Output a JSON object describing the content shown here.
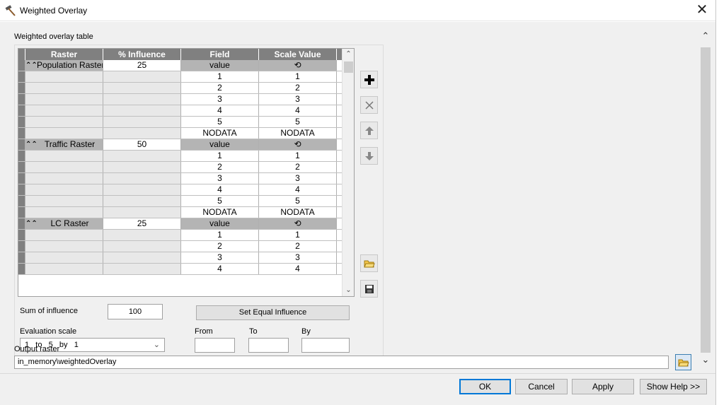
{
  "window": {
    "title": "Weighted Overlay",
    "icon": "hammer-icon",
    "close_glyph": "✕"
  },
  "section_label": "Weighted overlay table",
  "table": {
    "headers": [
      "Raster",
      "% Influence",
      "Field",
      "Scale Value"
    ],
    "scale_header_glyph": "⟲",
    "groups": [
      {
        "raster": "Population Raster",
        "influence": "25",
        "field": "value",
        "rows": [
          [
            "1",
            "1"
          ],
          [
            "2",
            "2"
          ],
          [
            "3",
            "3"
          ],
          [
            "4",
            "4"
          ],
          [
            "5",
            "5"
          ],
          [
            "NODATA",
            "NODATA"
          ]
        ]
      },
      {
        "raster": "Traffic Raster",
        "influence": "50",
        "field": "value",
        "rows": [
          [
            "1",
            "1"
          ],
          [
            "2",
            "2"
          ],
          [
            "3",
            "3"
          ],
          [
            "4",
            "4"
          ],
          [
            "5",
            "5"
          ],
          [
            "NODATA",
            "NODATA"
          ]
        ]
      },
      {
        "raster": "LC Raster",
        "influence": "25",
        "field": "value",
        "rows": [
          [
            "1",
            "1"
          ],
          [
            "2",
            "2"
          ],
          [
            "3",
            "3"
          ],
          [
            "4",
            "4"
          ]
        ]
      }
    ]
  },
  "sum_of_influence": {
    "label": "Sum of influence",
    "value": "100"
  },
  "set_equal_button": "Set Equal Influence",
  "evaluation_scale": {
    "label": "Evaluation scale",
    "selected": "1   to   5   by   1"
  },
  "range": {
    "from_label": "From",
    "to_label": "To",
    "by_label": "By",
    "from": "",
    "to": "",
    "by": ""
  },
  "output_raster": {
    "label": "Output raster",
    "value": "in_memory\\weightedOverlay"
  },
  "buttons": {
    "ok": "OK",
    "cancel": "Cancel",
    "apply": "Apply",
    "help": "Show Help >>"
  }
}
